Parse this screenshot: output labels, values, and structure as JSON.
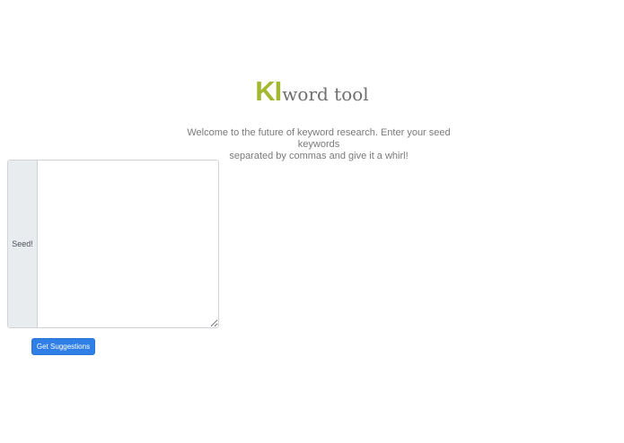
{
  "logo": {
    "mark": "KI",
    "text": "word tool"
  },
  "intro": {
    "line1": "Welcome to the future of keyword research. Enter your seed keywords",
    "line2": "separated by commas and give it a whirl!"
  },
  "form": {
    "addon_label": "Seed!",
    "textarea_value": "",
    "submit_label": "Get Suggestions"
  },
  "colors": {
    "logo_accent": "#a3b830",
    "button_primary": "#2f7fe6"
  }
}
